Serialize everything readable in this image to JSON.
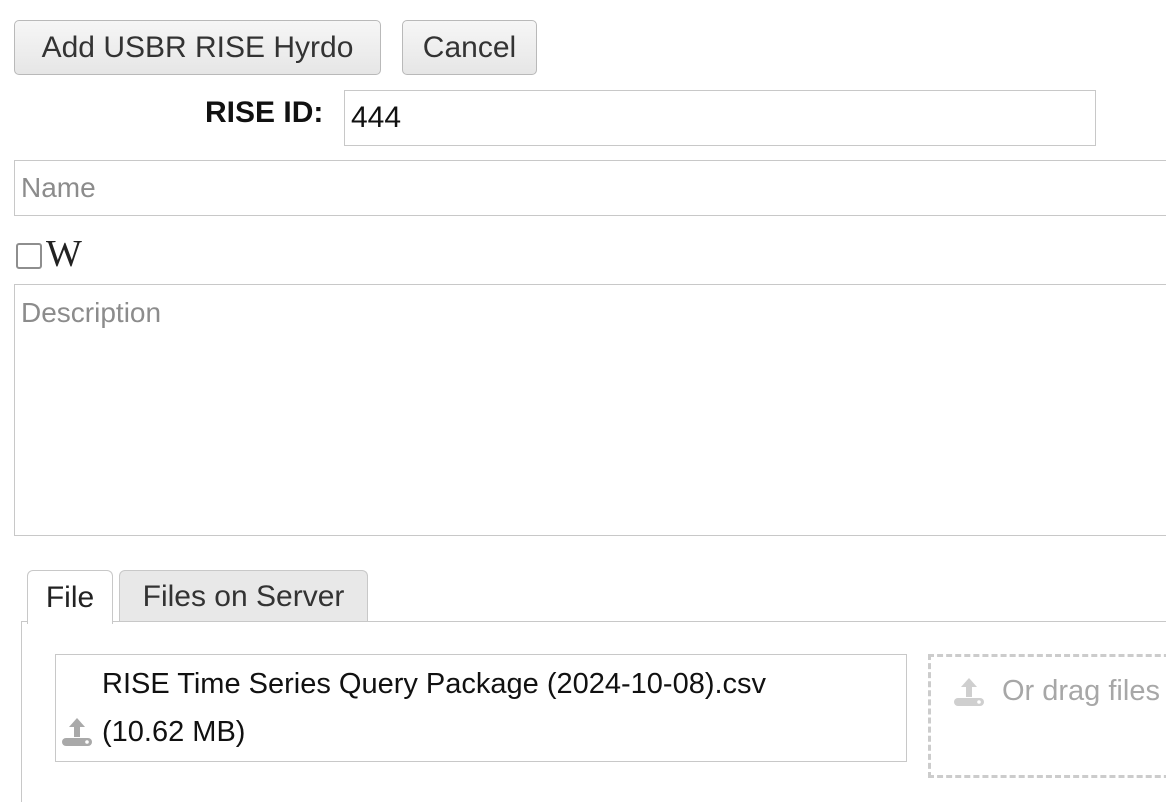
{
  "toolbar": {
    "add_label": "Add USBR RISE Hyrdo",
    "cancel_label": "Cancel"
  },
  "form": {
    "rise_id_label": "RISE ID:",
    "rise_id_value": "444",
    "name_placeholder": "Name",
    "name_value": "",
    "wiki_checked": false,
    "wiki_icon": "W",
    "description_placeholder": "Description",
    "description_value": ""
  },
  "tabs": [
    {
      "label": "File",
      "active": true
    },
    {
      "label": "Files on Server",
      "active": false
    }
  ],
  "upload": {
    "file_name": "RISE Time Series Query Package (2024-10-08).csv",
    "file_size": "(10.62 MB)",
    "file_icon": "upload-icon",
    "drop_text": "Or drag files",
    "drop_icon": "upload-icon"
  },
  "colors": {
    "border": "#c8c8c8",
    "placeholder": "#8c8c8c",
    "drop_text": "#a7a7a7",
    "tab_inactive_bg": "#e8e8e8"
  }
}
